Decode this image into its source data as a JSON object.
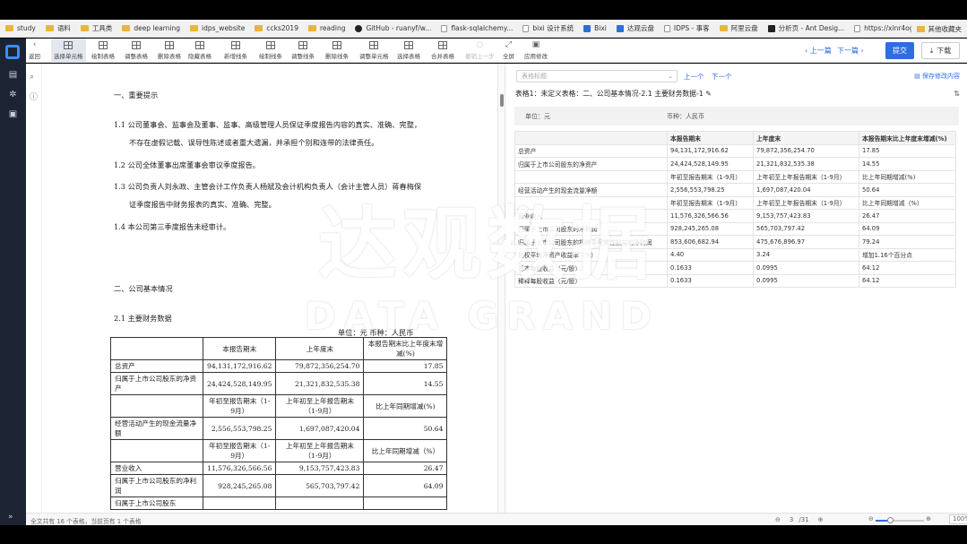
{
  "bookmarks": [
    {
      "icon": "folder",
      "label": "study"
    },
    {
      "icon": "folder",
      "label": "语料"
    },
    {
      "icon": "folder",
      "label": "工具类"
    },
    {
      "icon": "folder",
      "label": "deep learning"
    },
    {
      "icon": "folder",
      "label": "idps_website"
    },
    {
      "icon": "folder",
      "label": "ccks2019"
    },
    {
      "icon": "folder",
      "label": "reading"
    },
    {
      "icon": "gh",
      "label": "GitHub - ruanyf/w..."
    },
    {
      "icon": "page",
      "label": "flask-sqlalchemy..."
    },
    {
      "icon": "page",
      "label": "bixi 设计系统"
    },
    {
      "icon": "blue",
      "label": "Bixi"
    },
    {
      "icon": "blue",
      "label": "达观云盘"
    },
    {
      "icon": "page",
      "label": "IDPS - 事客"
    },
    {
      "icon": "folder",
      "label": "阿里云盘"
    },
    {
      "icon": "dark",
      "label": "分析页 - Ant Desig..."
    },
    {
      "icon": "page",
      "label": "https://xinr4ogz7..."
    }
  ],
  "bookmarks_other": "其他收藏夹",
  "toolbar": {
    "items": [
      {
        "label": "返回",
        "icon": "arrow",
        "glyph": "‹"
      },
      {
        "label": "选择单元格",
        "icon": "tbl",
        "active": true
      },
      {
        "label": "绘制表格",
        "icon": "tbl"
      },
      {
        "label": "调整表格",
        "icon": "tbl"
      },
      {
        "label": "删除表格",
        "icon": "tbl"
      },
      {
        "label": "隐藏表格",
        "icon": "tbl"
      },
      {
        "label": "新增线条",
        "icon": "tbl"
      },
      {
        "label": "绘制线条",
        "icon": "tbl"
      },
      {
        "label": "调整线条",
        "icon": "tbl"
      },
      {
        "label": "删除线条",
        "icon": "tbl"
      },
      {
        "label": "调整单元格",
        "icon": "tbl"
      },
      {
        "label": "选择表格",
        "icon": "tbl"
      },
      {
        "label": "合并表格",
        "icon": "tbl"
      },
      {
        "label": "撤销上一步",
        "icon": "arrow",
        "glyph": "○",
        "disabled": true
      },
      {
        "label": "全屏",
        "icon": "arrow",
        "glyph": "⤢"
      },
      {
        "label": "应用修改",
        "icon": "arrow",
        "glyph": "▣"
      }
    ],
    "prev_page": "‹ 上一篇",
    "next_page": "下一篇 ›",
    "submit": "提交",
    "download": "下载"
  },
  "doc": {
    "sec1_title": "一、重要提示",
    "p11a": "1.1 公司董事会、监事会及董事、监事、高级管理人员保证季度报告内容的真实、准确、完整，",
    "p11b": "不存在虚假记载、误导性陈述或者重大遗漏，并承担个别和连带的法律责任。",
    "p12": "1.2 公司全体董事出席董事会审议季度报告。",
    "p13a": "1.3 公司负责人刘永政、主管会计工作负责人杨斌及会计机构负责人（会计主管人员）蒋春梅保",
    "p13b": "证季度报告中财务报表的真实、准确、完整。",
    "p14": "1.4 本公司第三季度报告未经审计。",
    "sec2_title": "二、公司基本情况",
    "sub21": "2.1 主要财务数据",
    "unit_line": "单位：元 币种：人民币",
    "table": {
      "hdr_cur": "本报告期末",
      "hdr_last": "上年度末",
      "hdr_chg": "本报告期末比上年度末增减(%)",
      "r1": [
        "总资产",
        "94,131,172,916.62",
        "79,872,356,254.70",
        "17.85"
      ],
      "r2": [
        "归属于上市公司股东的净资产",
        "24,424,528,149.95",
        "21,321,832,535.38",
        "14.55"
      ],
      "h2": [
        "年初至报告期末（1-9月）",
        "上年初至上年报告期末（1-9月）",
        "比上年同期增减(%)"
      ],
      "r3": [
        "经营活动产生的现金流量净额",
        "2,556,553,798.25",
        "1,697,087,420.04",
        "50.64"
      ],
      "h3": [
        "年初至报告期末（1-9月）",
        "上年初至上年报告期末（1-9月）",
        "比上年同期增减（%）"
      ],
      "r4": [
        "营业收入",
        "11,576,326,566.56",
        "9,153,757,423.83",
        "26.47"
      ],
      "r5": [
        "归属于上市公司股东的净利润",
        "928,245,265.08",
        "565,703,797.42",
        "64.09"
      ],
      "r6": [
        "归属于上市公司股东"
      ]
    }
  },
  "right": {
    "select_placeholder": "表格标题",
    "prev": "上一个",
    "next": "下一个",
    "save_log": "保存修改内容",
    "title": "表格1：未定义表格：二、公司基本情况-2.1 主要财务数据-1",
    "unit_label": "单位：元",
    "currency_label": "币种：人民币",
    "rows": [
      [
        "",
        "本报告期末",
        "上年度末",
        "本报告期末比上年度末增减(%)"
      ],
      [
        "总资产",
        "94,131,172,916.62",
        "79,872,356,254.70",
        "17.85"
      ],
      [
        "归属于上市公司股东的净资产",
        "24,424,528,149.95",
        "21,321,832,535.38",
        "14.55"
      ],
      [
        "",
        "年初至报告期末（1-9月）",
        "上年初至上年报告期末（1-9月）",
        "比上年同期增减(%)"
      ],
      [
        "经营活动产生的现金流量净额",
        "2,556,553,798.25",
        "1,697,087,420.04",
        "50.64"
      ],
      [
        "",
        "年初至报告期末（1-9月）",
        "上年初至上年报告期末（1-9月）",
        "比上年同期增减（%）"
      ],
      [
        "营业收入",
        "11,576,326,566.56",
        "9,153,757,423.83",
        "26.47"
      ],
      [
        "归属于上市公司股东的净利润",
        "928,245,265.08",
        "565,703,797.42",
        "64.09"
      ],
      [
        "归属于上市公司股东的扣除非经常性损益的净利润",
        "853,606,682.94",
        "475,676,896.97",
        "79.24"
      ],
      [
        "加权平均净资产收益率（%）",
        "4.40",
        "3.24",
        "增加1.16个百分点"
      ],
      [
        "基本每股收益（元/股）",
        "0.1633",
        "0.0995",
        "64.12"
      ],
      [
        "稀释每股收益（元/股）",
        "0.1633",
        "0.0995",
        "64.12"
      ]
    ]
  },
  "watermark": {
    "cn": "达观数据",
    "en": "DATA GRAND"
  },
  "status": {
    "info": "全文共有 16 个表格，当前页有 1 个表格",
    "page_current": "3",
    "page_total": "/31",
    "zoom_level": 0.3,
    "zoom": "100%"
  }
}
